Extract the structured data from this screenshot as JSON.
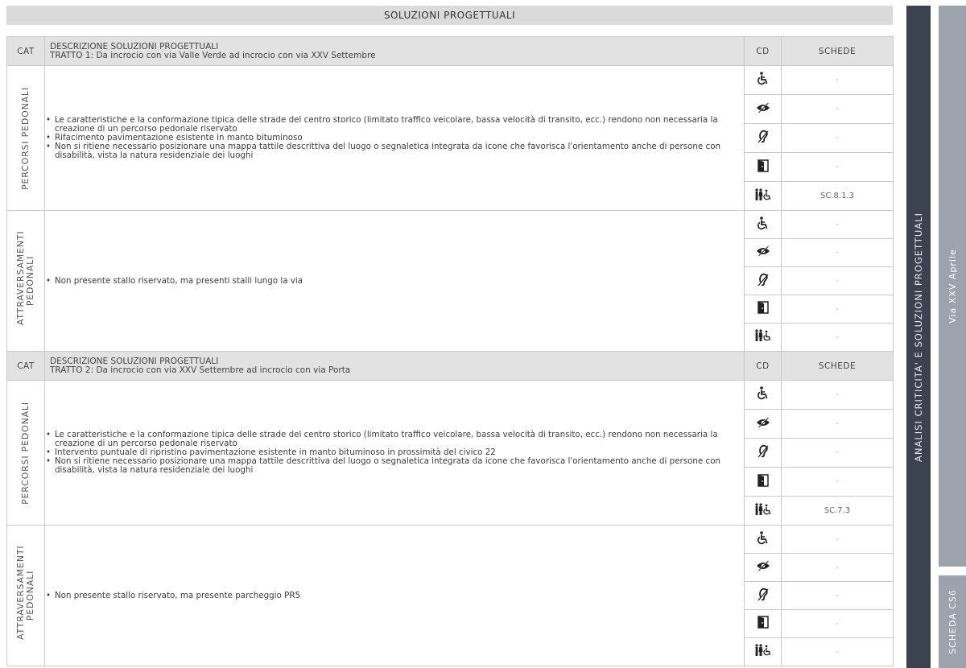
{
  "header": {
    "title": "SOLUZIONI PROGETTUALI"
  },
  "side": {
    "section": "ANALISI CRITICITA' E SOLUZIONI PROGETTUALI",
    "street": "Via XXV Aprile",
    "sheet": "SCHEDA CS6"
  },
  "columns": {
    "cat": "CAT",
    "desc": "DESCRIZIONE SOLUZIONI PROGETTUALI",
    "cd": "CD",
    "schede": "SCHEDE"
  },
  "icons": [
    "wheelchair-icon",
    "eye-blind-icon",
    "ear-deaf-icon",
    "door-exit-icon",
    "family-accessibility-icon"
  ],
  "tratti": [
    {
      "name": "TRATTO 1: Da incrocio con via Valle Verde ad incrocio con via XXV Settembre",
      "sections": [
        {
          "cat": "PERCORSI PEDONALI",
          "items": [
            "Le caratteristiche e la conformazione tipica delle strade del centro storico (limitato traffico veicolare, bassa velocità di transito, ecc.) rendono non necessaria la creazione di un percorso pedonale riservato",
            "Rifacimento pavimentazione esistente in manto bituminoso",
            "Non si ritiene necessario posizionare una mappa tattile descrittiva del luogo o segnaletica integrata da icone che favorisca l'orientamento anche di persone con disabilità, vista la natura residenziale dei luoghi"
          ],
          "schede": [
            "-",
            "-",
            "-",
            "-",
            "SC.8.1.3"
          ]
        },
        {
          "cat": "ATTRAVERSAMENTI PEDONALI",
          "items": [
            "Non presente stallo riservato, ma presenti stalli lungo la via"
          ],
          "schede": [
            "-",
            "-",
            "-",
            "-",
            "-"
          ]
        }
      ]
    },
    {
      "name": "TRATTO 2:  Da incrocio con via XXV Settembre ad incrocio con via Porta",
      "sections": [
        {
          "cat": "PERCORSI PEDONALI",
          "items": [
            "Le caratteristiche e la conformazione tipica delle strade del centro storico (limitato traffico veicolare, bassa velocità di transito, ecc.) rendono non necessaria la creazione di un percorso pedonale riservato",
            "Intervento puntuale di ripristino pavimentazione esistente in manto bituminoso in prossimità del civico 22",
            "Non si ritiene necessario posizionare una mappa tattile descrittiva del luogo o segnaletica integrata da icone che favorisca l'orientamento anche di persone con disabilità, vista la natura residenziale dei luoghi"
          ],
          "schede": [
            "-",
            "-",
            "-",
            "-",
            "SC.7.3"
          ]
        },
        {
          "cat": "ATTRAVERSAMENTI PEDONALI",
          "items": [
            "Non presente stallo riservato, ma presente parcheggio PR5"
          ],
          "schede": [
            "-",
            "-",
            "-",
            "-",
            "-"
          ]
        }
      ]
    }
  ]
}
